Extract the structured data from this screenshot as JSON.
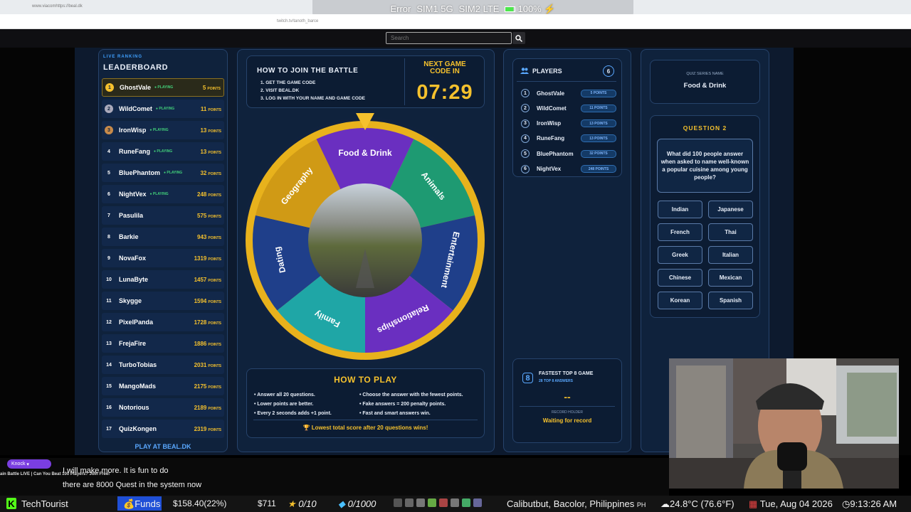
{
  "browser": {
    "tab_url": "www.viacomhttps://beal.dk",
    "address": "twitch.tv/tanoth_barce"
  },
  "status": {
    "error": "Error",
    "sim1": "SIM1 5G",
    "sim2": "SIM2 LTE",
    "battery": "100%"
  },
  "search": {
    "placeholder": "Search"
  },
  "leaderboard": {
    "kicker": "LIVE RANKING",
    "title": "LEADERBOARD",
    "playing_label": "● PLAYING",
    "points_label": "POINTS",
    "footer": "PLAY AT BEAL.DK",
    "rows": [
      {
        "rank": "1",
        "name": "GhostVale",
        "playing": true,
        "points": "5"
      },
      {
        "rank": "2",
        "name": "WildComet",
        "playing": true,
        "points": "11"
      },
      {
        "rank": "3",
        "name": "IronWisp",
        "playing": true,
        "points": "13"
      },
      {
        "rank": "4",
        "name": "RuneFang",
        "playing": true,
        "points": "13"
      },
      {
        "rank": "5",
        "name": "BluePhantom",
        "playing": true,
        "points": "32"
      },
      {
        "rank": "6",
        "name": "NightVex",
        "playing": true,
        "points": "248"
      },
      {
        "rank": "7",
        "name": "Pasulila",
        "playing": false,
        "points": "575"
      },
      {
        "rank": "8",
        "name": "Barkie",
        "playing": false,
        "points": "943"
      },
      {
        "rank": "9",
        "name": "NovaFox",
        "playing": false,
        "points": "1319"
      },
      {
        "rank": "10",
        "name": "LunaByte",
        "playing": false,
        "points": "1457"
      },
      {
        "rank": "11",
        "name": "Skygge",
        "playing": false,
        "points": "1594"
      },
      {
        "rank": "12",
        "name": "PixelPanda",
        "playing": false,
        "points": "1728"
      },
      {
        "rank": "13",
        "name": "FrejaFire",
        "playing": false,
        "points": "1886"
      },
      {
        "rank": "14",
        "name": "TurboTobias",
        "playing": false,
        "points": "2031"
      },
      {
        "rank": "15",
        "name": "MangoMads",
        "playing": false,
        "points": "2175"
      },
      {
        "rank": "16",
        "name": "Notorious",
        "playing": false,
        "points": "2189"
      },
      {
        "rank": "17",
        "name": "QuizKongen",
        "playing": false,
        "points": "2319"
      }
    ]
  },
  "join": {
    "title": "HOW TO JOIN THE BATTLE",
    "steps": [
      "1. GET THE GAME CODE",
      "2. VISIT BEAL.DK",
      "3. LOG IN WITH YOUR NAME AND GAME CODE"
    ],
    "next_label": "NEXT GAME CODE IN",
    "timer": "07:29"
  },
  "wheel": {
    "segments": [
      "Food & Drink",
      "Animals",
      "Entertainment",
      "Relationships",
      "Family",
      "Dating",
      "Geography"
    ],
    "colors": [
      "#6a2fc0",
      "#1e9a72",
      "#1f3f8a",
      "#6a2fc0",
      "#1fa6a6",
      "#1f3f8a",
      "#d09a15"
    ]
  },
  "how_to_play": {
    "title": "HOW TO PLAY",
    "left": [
      "Answer all 20 questions.",
      "Lower points are better.",
      "Every 2 seconds adds +1 point."
    ],
    "right": [
      "Choose the answer with the fewest points.",
      "Fake answers = 200 penalty points.",
      "Fast and smart answers win."
    ],
    "footer": "Lowest total score after 20 questions wins!"
  },
  "players": {
    "title": "PLAYERS",
    "count": "6",
    "points_label": "POINTS",
    "rows": [
      {
        "n": "1",
        "name": "GhostVale",
        "points": "5"
      },
      {
        "n": "2",
        "name": "WildComet",
        "points": "11"
      },
      {
        "n": "3",
        "name": "IronWisp",
        "points": "13"
      },
      {
        "n": "4",
        "name": "RuneFang",
        "points": "13"
      },
      {
        "n": "5",
        "name": "BluePhantom",
        "points": "32"
      },
      {
        "n": "6",
        "name": "NightVex",
        "points": "248"
      }
    ]
  },
  "record": {
    "badge": "8",
    "title": "FASTEST TOP 8 GAME",
    "subtitle": "28 TOP 8 ANSWERS",
    "value": "--",
    "holder_label": "RECORD HOLDER",
    "holder": "Waiting for record"
  },
  "quiz": {
    "series_label": "QUIZ SERIES NAME",
    "series": "Food & Drink",
    "question_label": "QUESTION 2",
    "question": "What did 100 people answer when asked to name well-known a popular cuisine among young people?",
    "options": [
      "Indian",
      "Japanese",
      "French",
      "Thai",
      "Greek",
      "Italian",
      "Chinese",
      "Mexican",
      "Korean",
      "Spanish"
    ]
  },
  "chat": {
    "knock": "Knock",
    "line1": "I will make more. It is fun to do",
    "line2": "there are 8000 Quest in the system now",
    "title_overlay": "ain Battle LIVE | Can You Beat 100 Players? Join Free!"
  },
  "bottom": {
    "channel": "TechTourist",
    "funds": "Funds",
    "money": "$158.40(22%)",
    "money2": "$711",
    "stars": "0/10",
    "gems": "0/1000",
    "location": "Calibutbut, Bacolor, Philippines",
    "country": "PH",
    "weather": "24.8°C (76.6°F)",
    "date": "Tue, Aug 04 2026",
    "time": "9:13:26 AM"
  }
}
